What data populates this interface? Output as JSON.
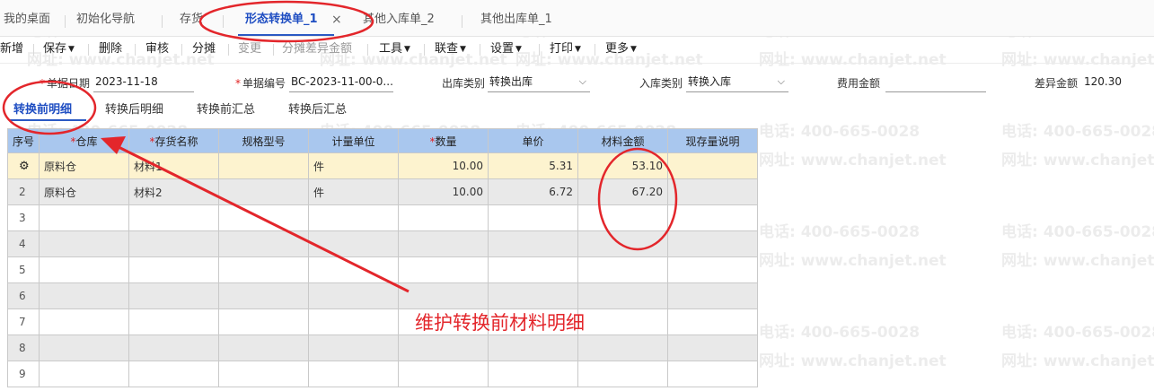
{
  "tabs": [
    {
      "label": "我的桌面"
    },
    {
      "label": "初始化导航"
    },
    {
      "label": "存货"
    },
    {
      "label": "形态转换单_1",
      "close": "×"
    },
    {
      "label": "其他入库单_2"
    },
    {
      "label": "其他出库单_1"
    }
  ],
  "toolbar": {
    "new": "新增",
    "save": "保存",
    "delete": "删除",
    "audit": "审核",
    "allocate": "分摊",
    "change": "变更",
    "allocate_diff": "分摊差异金额",
    "tools": "工具",
    "linked_query": "联查",
    "settings": "设置",
    "print": "打印",
    "more": "更多"
  },
  "form": {
    "date_label": "单据日期",
    "date_value": "2023-11-18",
    "code_label": "单据编号",
    "code_value": "BC-2023-11-00-0...",
    "out_type_label": "出库类别",
    "out_type_value": "转换出库",
    "in_type_label": "入库类别",
    "in_type_value": "转换入库",
    "fee_label": "费用金额",
    "fee_value": "",
    "diff_label": "差异金额",
    "diff_value": "120.30"
  },
  "detail_tabs": [
    "转换前明细",
    "转换后明细",
    "转换前汇总",
    "转换后汇总"
  ],
  "grid": {
    "headers": [
      "序号",
      "仓库",
      "存货名称",
      "规格型号",
      "计量单位",
      "数量",
      "单价",
      "材料金额",
      "现存量说明"
    ],
    "rows": [
      {
        "idx": "",
        "warehouse": "原料仓",
        "item": "材料1",
        "spec": "",
        "unit": "件",
        "qty": "10.00",
        "price": "5.31",
        "amount": "53.10",
        "note": ""
      },
      {
        "idx": "2",
        "warehouse": "原料仓",
        "item": "材料2",
        "spec": "",
        "unit": "件",
        "qty": "10.00",
        "price": "6.72",
        "amount": "67.20",
        "note": ""
      },
      {
        "idx": "3"
      },
      {
        "idx": "4"
      },
      {
        "idx": "5"
      },
      {
        "idx": "6"
      },
      {
        "idx": "7"
      },
      {
        "idx": "8"
      },
      {
        "idx": "9"
      }
    ]
  },
  "annotation": {
    "text": "维护转换前材料明细"
  },
  "watermark": {
    "phone": "电话: 400-665-0028",
    "site": "网址: www.chanjet.net"
  },
  "colors": {
    "accent": "#2b59c3",
    "header_bg": "#a9c7ee",
    "annotation": "#e3262b",
    "row_highlight": "#fdf3cf"
  }
}
